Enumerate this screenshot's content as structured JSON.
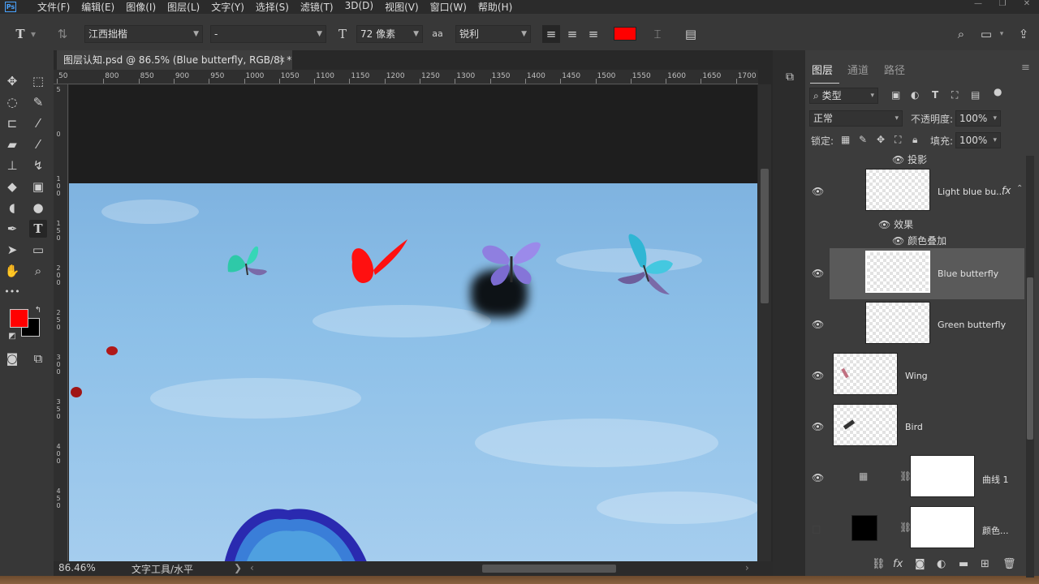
{
  "app": {
    "logo": "Ps"
  },
  "menus": [
    "文件(F)",
    "编辑(E)",
    "图像(I)",
    "图层(L)",
    "文字(Y)",
    "选择(S)",
    "滤镜(T)",
    "3D(D)",
    "视图(V)",
    "窗口(W)",
    "帮助(H)"
  ],
  "window_controls": {
    "minimize": "—",
    "restore": "❐",
    "close": "✕"
  },
  "options": {
    "tool_icon": "T",
    "font_family": "江西拙楷",
    "font_style": "-",
    "size_icon": "T",
    "font_size": "72 像素",
    "aa_icon": "aa",
    "antialias": "锐利",
    "text_color": "#ff0000"
  },
  "document": {
    "tab_title": "图层认知.psd @ 86.5% (Blue butterfly, RGB/8) *",
    "close": "×"
  },
  "ruler_top": [
    "50",
    "800",
    "850",
    "900",
    "950",
    "1000",
    "1050",
    "1100",
    "1150",
    "1200",
    "1250",
    "1300",
    "1350",
    "1400",
    "1450",
    "1500",
    "1550",
    "1600",
    "1650",
    "1700"
  ],
  "ruler_left": [
    "5",
    "0",
    "1 0 0",
    "1 5 0",
    "2 0 0",
    "2 5 0",
    "3 0 0",
    "3 5 0",
    "4 0 0",
    "4 5 0"
  ],
  "tools": {
    "foreground_color": "#ff0000",
    "background_color": "#000000",
    "more": "•••"
  },
  "status": {
    "zoom": "86.46%",
    "text": "文字工具/水平",
    "arrow": "❯"
  },
  "layers_panel": {
    "tabs": [
      "图层",
      "通道",
      "路径"
    ],
    "filter_kind": "类型",
    "blend_mode": "正常",
    "opacity_label": "不透明度:",
    "opacity_value": "100%",
    "lock_label": "锁定:",
    "fill_label": "填充:",
    "fill_value": "100%",
    "top_effect": "投影",
    "layers": [
      {
        "name": "Light blue bu...",
        "fx": "fx",
        "effects_label": "效果",
        "effect": "颜色叠加"
      },
      {
        "name": "Blue butterfly"
      },
      {
        "name": "Green butterfly"
      },
      {
        "name": "Wing"
      },
      {
        "name": "Bird"
      },
      {
        "name": "曲线 1"
      },
      {
        "name": "颜色..."
      }
    ]
  },
  "colors": {
    "accent_blue": "#4aa3ff",
    "selected_layer": "#5a5a5a"
  }
}
